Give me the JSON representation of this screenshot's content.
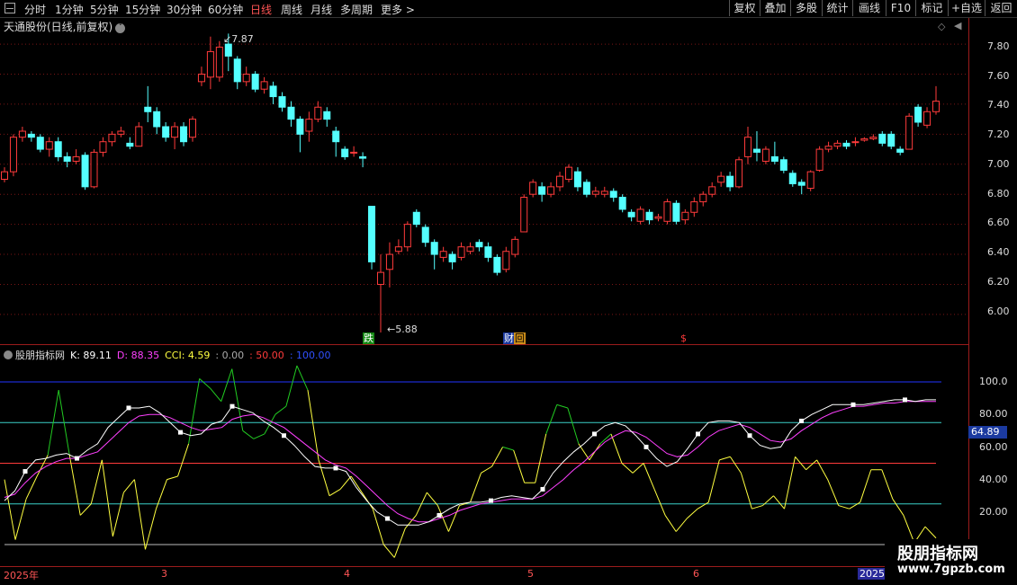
{
  "toolbar": {
    "periods": [
      "分时",
      "1分钟",
      "5分钟",
      "15分钟",
      "30分钟",
      "60分钟",
      "日线",
      "周线",
      "月线",
      "多周期",
      "更多 >"
    ],
    "active_period": "日线",
    "right_buttons": [
      "复权",
      "叠加",
      "多股",
      "统计",
      "画线",
      "F10",
      "标记",
      "+自选",
      "返回"
    ]
  },
  "chart_title": "天通股份(日线,前复权)",
  "annotations": {
    "high": "7.87",
    "low": "5.88",
    "badge_die": "跌",
    "badge_cai": "财",
    "badge_hui": "回",
    "badge_dollar": "$"
  },
  "indicator": {
    "name": "股朋指标网",
    "k": "K: 89.11",
    "d": "D: 88.35",
    "cci": "CCI: 4.59",
    "v0": ": 0.00",
    "v50": ": 50.00",
    "v100": ": 100.00",
    "current": "64.89"
  },
  "price_axis": [
    "7.80",
    "7.60",
    "7.40",
    "7.20",
    "7.00",
    "6.80",
    "6.60",
    "6.40",
    "6.20",
    "6.00"
  ],
  "ind_axis": [
    "100.0",
    "80.00",
    "60.00",
    "40.00",
    "20.00"
  ],
  "dates": [
    "2025年",
    "3",
    "4",
    "5",
    "6",
    "2025/"
  ],
  "watermark": {
    "line1": "股朋指标网",
    "line2": "www.7gpzb.com"
  },
  "colors": {
    "up": "#ff3b3b",
    "down": "#54ffff",
    "k": "#ffffff",
    "d": "#ff40ff",
    "cci": "#ffff40",
    "green": "#22cc22"
  },
  "chart_data": {
    "type": "candlestick",
    "ylim": [
      5.82,
      7.95
    ],
    "candles": [
      [
        6.9,
        6.95,
        6.88,
        6.98
      ],
      [
        6.95,
        7.18,
        6.92,
        7.2
      ],
      [
        7.18,
        7.22,
        7.15,
        7.25
      ],
      [
        7.2,
        7.18,
        7.15,
        7.22
      ],
      [
        7.18,
        7.1,
        7.08,
        7.2
      ],
      [
        7.1,
        7.15,
        7.05,
        7.18
      ],
      [
        7.15,
        7.05,
        7.02,
        7.18
      ],
      [
        7.05,
        7.02,
        6.98,
        7.08
      ],
      [
        7.02,
        7.05,
        7.0,
        7.1
      ],
      [
        7.06,
        6.85,
        6.83,
        7.08
      ],
      [
        6.85,
        7.08,
        6.84,
        7.1
      ],
      [
        7.08,
        7.15,
        7.05,
        7.18
      ],
      [
        7.15,
        7.2,
        7.12,
        7.22
      ],
      [
        7.2,
        7.22,
        7.18,
        7.25
      ],
      [
        7.14,
        7.12,
        7.1,
        7.18
      ],
      [
        7.12,
        7.25,
        7.12,
        7.28
      ],
      [
        7.38,
        7.35,
        7.28,
        7.52
      ],
      [
        7.35,
        7.25,
        7.2,
        7.38
      ],
      [
        7.25,
        7.18,
        7.15,
        7.28
      ],
      [
        7.18,
        7.25,
        7.1,
        7.28
      ],
      [
        7.25,
        7.15,
        7.12,
        7.28
      ],
      [
        7.18,
        7.3,
        7.15,
        7.32
      ],
      [
        7.55,
        7.6,
        7.52,
        7.65
      ],
      [
        7.58,
        7.75,
        7.5,
        7.85
      ],
      [
        7.58,
        7.78,
        7.55,
        7.82
      ],
      [
        7.8,
        7.72,
        7.62,
        7.87
      ],
      [
        7.7,
        7.55,
        7.5,
        7.72
      ],
      [
        7.55,
        7.6,
        7.52,
        7.65
      ],
      [
        7.6,
        7.5,
        7.48,
        7.62
      ],
      [
        7.5,
        7.55,
        7.47,
        7.58
      ],
      [
        7.52,
        7.45,
        7.4,
        7.55
      ],
      [
        7.45,
        7.38,
        7.35,
        7.48
      ],
      [
        7.38,
        7.3,
        7.25,
        7.42
      ],
      [
        7.3,
        7.2,
        7.08,
        7.32
      ],
      [
        7.22,
        7.3,
        7.15,
        7.35
      ],
      [
        7.3,
        7.38,
        7.28,
        7.42
      ],
      [
        7.35,
        7.3,
        7.25,
        7.38
      ],
      [
        7.22,
        7.15,
        7.05,
        7.25
      ],
      [
        7.1,
        7.05,
        7.03,
        7.12
      ],
      [
        7.08,
        7.08,
        7.05,
        7.12
      ],
      [
        7.05,
        7.04,
        6.98,
        7.08
      ],
      [
        6.72,
        6.35,
        6.3,
        6.72
      ],
      [
        6.2,
        6.28,
        5.88,
        6.4
      ],
      [
        6.3,
        6.4,
        6.18,
        6.48
      ],
      [
        6.42,
        6.45,
        6.4,
        6.5
      ],
      [
        6.45,
        6.6,
        6.42,
        6.62
      ],
      [
        6.68,
        6.6,
        6.58,
        6.7
      ],
      [
        6.58,
        6.48,
        6.45,
        6.6
      ],
      [
        6.48,
        6.4,
        6.3,
        6.5
      ],
      [
        6.38,
        6.42,
        6.35,
        6.45
      ],
      [
        6.4,
        6.35,
        6.3,
        6.42
      ],
      [
        6.38,
        6.45,
        6.36,
        6.48
      ],
      [
        6.42,
        6.45,
        6.4,
        6.48
      ],
      [
        6.48,
        6.45,
        6.42,
        6.5
      ],
      [
        6.45,
        6.38,
        6.35,
        6.48
      ],
      [
        6.38,
        6.28,
        6.26,
        6.4
      ],
      [
        6.3,
        6.42,
        6.28,
        6.45
      ],
      [
        6.4,
        6.5,
        6.38,
        6.52
      ],
      [
        6.55,
        6.78,
        6.55,
        6.8
      ],
      [
        6.8,
        6.88,
        6.78,
        6.9
      ],
      [
        6.85,
        6.8,
        6.75,
        6.88
      ],
      [
        6.8,
        6.85,
        6.78,
        6.88
      ],
      [
        6.85,
        6.92,
        6.82,
        6.95
      ],
      [
        6.9,
        6.98,
        6.88,
        7.0
      ],
      [
        6.95,
        6.85,
        6.82,
        6.98
      ],
      [
        6.88,
        6.8,
        6.78,
        6.9
      ],
      [
        6.8,
        6.82,
        6.78,
        6.85
      ],
      [
        6.8,
        6.82,
        6.78,
        6.85
      ],
      [
        6.82,
        6.78,
        6.75,
        6.84
      ],
      [
        6.78,
        6.7,
        6.68,
        6.8
      ],
      [
        6.68,
        6.65,
        6.62,
        6.7
      ],
      [
        6.62,
        6.7,
        6.6,
        6.72
      ],
      [
        6.68,
        6.63,
        6.6,
        6.7
      ],
      [
        6.64,
        6.65,
        6.62,
        6.67
      ],
      [
        6.62,
        6.75,
        6.6,
        6.77
      ],
      [
        6.74,
        6.62,
        6.6,
        6.76
      ],
      [
        6.63,
        6.68,
        6.6,
        6.7
      ],
      [
        6.68,
        6.75,
        6.65,
        6.78
      ],
      [
        6.75,
        6.8,
        6.72,
        6.82
      ],
      [
        6.8,
        6.85,
        6.78,
        6.88
      ],
      [
        6.88,
        6.92,
        6.85,
        6.95
      ],
      [
        6.92,
        6.85,
        6.82,
        6.95
      ],
      [
        6.85,
        7.03,
        6.84,
        7.05
      ],
      [
        7.05,
        7.18,
        7.0,
        7.25
      ],
      [
        7.1,
        7.08,
        7.02,
        7.22
      ],
      [
        7.02,
        7.1,
        7.0,
        7.12
      ],
      [
        7.05,
        7.02,
        7.0,
        7.15
      ],
      [
        7.03,
        6.96,
        6.94,
        7.05
      ],
      [
        6.94,
        6.87,
        6.85,
        6.96
      ],
      [
        6.88,
        6.86,
        6.8,
        6.9
      ],
      [
        6.84,
        6.95,
        6.82,
        6.96
      ],
      [
        6.96,
        7.1,
        6.95,
        7.12
      ],
      [
        7.1,
        7.12,
        7.08,
        7.15
      ],
      [
        7.12,
        7.14,
        7.1,
        7.16
      ],
      [
        7.14,
        7.12,
        7.1,
        7.16
      ],
      [
        7.15,
        7.15,
        7.12,
        7.18
      ],
      [
        7.16,
        7.17,
        7.15,
        7.18
      ],
      [
        7.17,
        7.18,
        7.16,
        7.2
      ],
      [
        7.2,
        7.14,
        7.12,
        7.22
      ],
      [
        7.2,
        7.12,
        7.1,
        7.22
      ],
      [
        7.1,
        7.08,
        7.06,
        7.12
      ],
      [
        7.1,
        7.32,
        7.1,
        7.34
      ],
      [
        7.38,
        7.28,
        7.25,
        7.4
      ],
      [
        7.26,
        7.35,
        7.24,
        7.38
      ],
      [
        7.35,
        7.42,
        7.33,
        7.52
      ]
    ],
    "k": [
      27,
      33,
      45,
      52,
      53,
      55,
      56,
      53,
      58,
      62,
      72,
      78,
      84,
      84,
      85,
      81,
      75,
      69,
      67,
      68,
      74,
      76,
      85,
      83,
      81,
      76,
      72,
      67,
      61,
      54,
      48,
      47,
      47,
      45,
      35,
      27,
      20,
      16,
      12,
      12,
      12,
      14,
      18,
      22,
      25,
      26,
      26,
      27,
      29,
      30,
      29,
      28,
      34,
      44,
      51,
      57,
      62,
      68,
      73,
      75,
      73,
      67,
      60,
      53,
      48,
      51,
      59,
      68,
      75,
      76,
      76,
      75,
      67,
      61,
      59,
      60,
      70,
      76,
      80,
      83,
      86,
      86,
      86,
      86,
      87,
      88,
      89,
      89,
      88,
      89,
      89
    ],
    "d": [
      29,
      31,
      38,
      44,
      48,
      51,
      53,
      53,
      55,
      57,
      63,
      69,
      75,
      79,
      80,
      80,
      78,
      75,
      72,
      70,
      71,
      72,
      77,
      79,
      80,
      78,
      75,
      72,
      67,
      62,
      57,
      52,
      49,
      47,
      42,
      36,
      30,
      24,
      19,
      16,
      14,
      14,
      16,
      18,
      21,
      23,
      25,
      26,
      27,
      28,
      28,
      28,
      30,
      35,
      40,
      46,
      51,
      57,
      63,
      67,
      70,
      69,
      66,
      61,
      56,
      54,
      55,
      60,
      66,
      70,
      72,
      74,
      72,
      68,
      64,
      63,
      65,
      70,
      74,
      78,
      81,
      83,
      85,
      85,
      86,
      87,
      87,
      88,
      88,
      88,
      88
    ],
    "cci": [
      40,
      3,
      28,
      42,
      55,
      95,
      55,
      18,
      25,
      52,
      5,
      32,
      40,
      -3,
      22,
      40,
      42,
      62,
      102,
      96,
      88,
      108,
      70,
      65,
      68,
      80,
      85,
      110,
      95,
      52,
      30,
      34,
      42,
      32,
      22,
      0,
      -8,
      10,
      18,
      32,
      24,
      8,
      24,
      26,
      44,
      48,
      60,
      58,
      38,
      38,
      68,
      86,
      84,
      62,
      52,
      62,
      68,
      50,
      44,
      50,
      34,
      18,
      8,
      16,
      22,
      26,
      52,
      54,
      44,
      22,
      24,
      30,
      22,
      54,
      46,
      52,
      40,
      24,
      22,
      26,
      46,
      46,
      28,
      18,
      1,
      11,
      4
    ],
    "lines": {
      "l100": 100,
      "l75": 75,
      "l50": 50,
      "l25": 25,
      "l0": 0
    }
  }
}
